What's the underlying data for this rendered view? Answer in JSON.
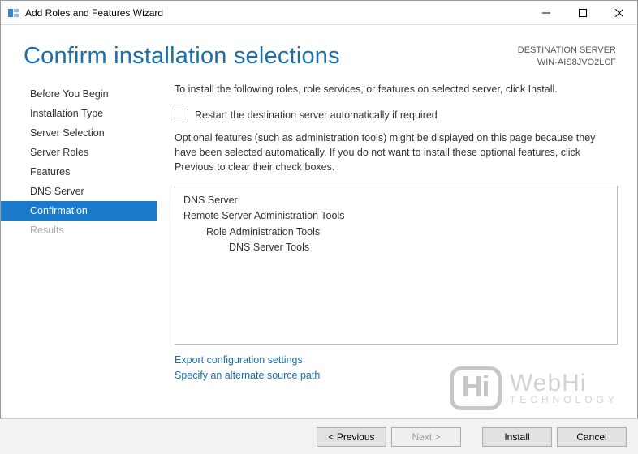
{
  "window": {
    "title": "Add Roles and Features Wizard"
  },
  "header": {
    "title": "Confirm installation selections",
    "destination_label": "DESTINATION SERVER",
    "destination_server": "WIN-AIS8JVO2LCF"
  },
  "sidebar": {
    "items": [
      {
        "label": "Before You Begin",
        "state": "normal"
      },
      {
        "label": "Installation Type",
        "state": "normal"
      },
      {
        "label": "Server Selection",
        "state": "normal"
      },
      {
        "label": "Server Roles",
        "state": "normal"
      },
      {
        "label": "Features",
        "state": "normal"
      },
      {
        "label": "DNS Server",
        "state": "normal"
      },
      {
        "label": "Confirmation",
        "state": "selected"
      },
      {
        "label": "Results",
        "state": "disabled"
      }
    ]
  },
  "main": {
    "instruction": "To install the following roles, role services, or features on selected server, click Install.",
    "restart_checkbox_label": "Restart the destination server automatically if required",
    "restart_checked": false,
    "optional_note": "Optional features (such as administration tools) might be displayed on this page because they have been selected automatically. If you do not want to install these optional features, click Previous to clear their check boxes.",
    "selections": [
      {
        "label": "DNS Server",
        "indent": 0
      },
      {
        "label": "Remote Server Administration Tools",
        "indent": 0
      },
      {
        "label": "Role Administration Tools",
        "indent": 1
      },
      {
        "label": "DNS Server Tools",
        "indent": 2
      }
    ],
    "links": {
      "export": "Export configuration settings",
      "alt_source": "Specify an alternate source path"
    }
  },
  "footer": {
    "previous": "< Previous",
    "next": "Next >",
    "install": "Install",
    "cancel": "Cancel"
  },
  "watermark": {
    "hi": "Hi",
    "brand": "WebHi",
    "tag": "TECHNOLOGY"
  }
}
